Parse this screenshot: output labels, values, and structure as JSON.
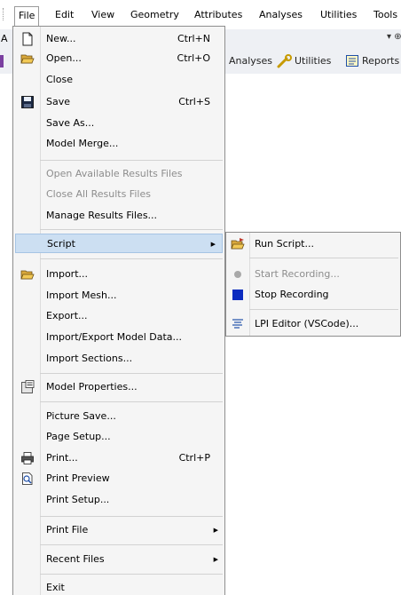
{
  "menubar": {
    "items": [
      "File",
      "Edit",
      "View",
      "Geometry",
      "Attributes",
      "Analyses",
      "Utilities",
      "Tools"
    ]
  },
  "panel": {
    "letter": "A",
    "letter2": "A",
    "pin_controls": "▾ ⊕ ×",
    "toolbar": [
      "Analyses",
      "Utilities",
      "Reports"
    ]
  },
  "file_menu": {
    "items": [
      {
        "label": "New...",
        "shortcut": "Ctrl+N",
        "icon": "new-document-icon"
      },
      {
        "label": "Open...",
        "shortcut": "Ctrl+O",
        "icon": "open-folder-icon"
      },
      {
        "label": "Close"
      },
      {
        "label": "Save",
        "shortcut": "Ctrl+S",
        "icon": "save-disk-icon"
      },
      {
        "label": "Save As..."
      },
      {
        "label": "Model Merge..."
      },
      {
        "label": "Open Available Results Files",
        "disabled": true
      },
      {
        "label": "Close All Results Files",
        "disabled": true
      },
      {
        "label": "Manage Results Files..."
      },
      {
        "label": "Script",
        "submenu": true
      },
      {
        "label": "Import...",
        "icon": "import-folder-icon"
      },
      {
        "label": "Import Mesh..."
      },
      {
        "label": "Export..."
      },
      {
        "label": "Import/Export Model Data..."
      },
      {
        "label": "Import Sections..."
      },
      {
        "label": "Model Properties...",
        "icon": "model-properties-icon"
      },
      {
        "label": "Picture Save..."
      },
      {
        "label": "Page Setup..."
      },
      {
        "label": "Print...",
        "shortcut": "Ctrl+P",
        "icon": "printer-icon"
      },
      {
        "label": "Print Preview",
        "icon": "print-preview-icon"
      },
      {
        "label": "Print Setup..."
      },
      {
        "label": "Print File",
        "submenu": true
      },
      {
        "label": "Recent Files",
        "submenu": true
      },
      {
        "label": "Exit"
      }
    ]
  },
  "script_submenu": {
    "items": [
      {
        "label": "Run Script...",
        "icon": "run-script-folder-icon"
      },
      {
        "label": "Start Recording...",
        "disabled": true,
        "icon": "record-dot-icon"
      },
      {
        "label": "Stop Recording",
        "icon": "stop-square-icon"
      },
      {
        "label": "LPI Editor (VSCode)...",
        "icon": "editor-lines-icon"
      }
    ]
  },
  "colors": {
    "menu_bg": "#f5f5f5",
    "highlight": "#ccdff2",
    "highlight_border": "#a6c4e4",
    "disabled_text": "#8d8d8d",
    "stop_icon": "#0b2bbf"
  }
}
